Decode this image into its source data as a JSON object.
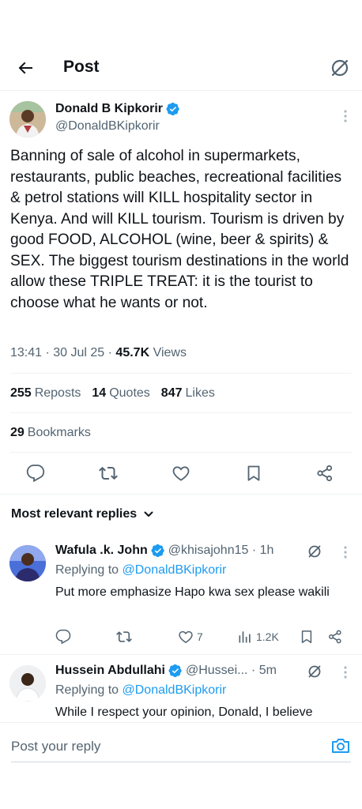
{
  "header": {
    "title": "Post"
  },
  "post": {
    "author_name": "Donald B Kipkorir",
    "author_handle": "@DonaldBKipkorir",
    "text": "Banning of sale of alcohol in supermarkets, restaurants, public beaches, recreational facilities & petrol stations will KILL hospitality sector in Kenya. And will KILL tourism. Tourism is driven by good FOOD, ALCOHOL (wine, beer & spirits) & SEX. The biggest tourism destinations in the world allow these TRIPLE TREAT: it is the tourist to choose what he wants or not.",
    "time": "13:41 · 30 Jul 25 · ",
    "views_count": "45.7K",
    "views_label": " Views",
    "reposts_count": "255",
    "reposts_label": "Reposts",
    "quotes_count": "14",
    "quotes_label": "Quotes",
    "likes_count": "847",
    "likes_label": "Likes",
    "bookmarks_count": "29",
    "bookmarks_label": "Bookmarks"
  },
  "replies_section": {
    "title": "Most relevant replies"
  },
  "replies": [
    {
      "name": "Wafula .k. John",
      "handle_time": "@khisajohn15 · 1h",
      "replying_prefix": "Replying to ",
      "replying_to": "@DonaldBKipkorir",
      "text": "Put more emphasize Hapo kwa sex please wakili",
      "likes": "7",
      "views": "1.2K"
    },
    {
      "name": "Hussein Abdullahi",
      "handle_time": "@Hussei... · 5m",
      "replying_prefix": "Replying to ",
      "replying_to": "@DonaldBKipkorir",
      "text": "While I respect your opinion, Donald, I believe"
    }
  ],
  "composer": {
    "placeholder": "Post your reply"
  },
  "colors": {
    "accent": "#1d9bf0",
    "text": "#0f1419",
    "muted": "#536471",
    "divider": "#eff3f4"
  }
}
